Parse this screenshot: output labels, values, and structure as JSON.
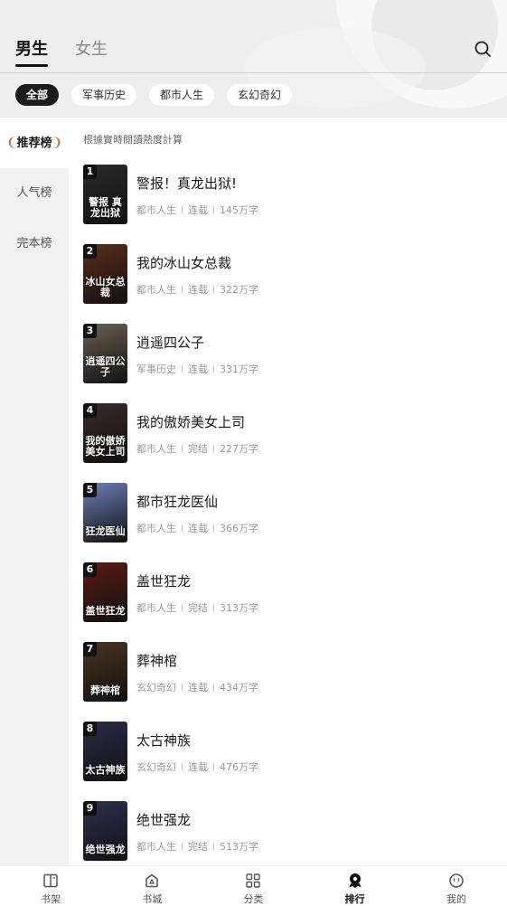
{
  "header": {
    "tabs": [
      {
        "label": "男生"
      },
      {
        "label": "女生"
      }
    ]
  },
  "chips": [
    {
      "label": "全部"
    },
    {
      "label": "军事历史"
    },
    {
      "label": "都市人生"
    },
    {
      "label": "玄幻奇幻"
    }
  ],
  "sidebar": {
    "items": [
      {
        "label": "推荐榜"
      },
      {
        "label": "人气榜"
      },
      {
        "label": "完本榜"
      }
    ]
  },
  "list": {
    "note": "根據實時閱讀熱度計算",
    "books": [
      {
        "rank": "1",
        "title": "警报！真龙出狱!",
        "category": "都市人生",
        "status": "连载",
        "words": "145万字",
        "cover_text": "警报 真龙出狱",
        "cover_color": "#2a2a2a"
      },
      {
        "rank": "2",
        "title": "我的冰山女总裁",
        "category": "都市人生",
        "status": "连载",
        "words": "322万字",
        "cover_text": "冰山女总裁",
        "cover_color": "#5a2d1a"
      },
      {
        "rank": "3",
        "title": "逍遥四公子",
        "category": "军事历史",
        "status": "连载",
        "words": "331万字",
        "cover_text": "逍遥四公子",
        "cover_color": "#6b5f52"
      },
      {
        "rank": "4",
        "title": "我的傲娇美女上司",
        "category": "都市人生",
        "status": "完结",
        "words": "227万字",
        "cover_text": "我的傲娇美女上司",
        "cover_color": "#3a2a28"
      },
      {
        "rank": "5",
        "title": "都市狂龙医仙",
        "category": "都市人生",
        "status": "连载",
        "words": "366万字",
        "cover_text": "狂龙医仙",
        "cover_color": "#6d7fb8"
      },
      {
        "rank": "6",
        "title": "盖世狂龙",
        "category": "都市人生",
        "status": "完结",
        "words": "313万字",
        "cover_text": "盖世狂龙",
        "cover_color": "#5c1a12"
      },
      {
        "rank": "7",
        "title": "葬神棺",
        "category": "玄幻奇幻",
        "status": "连载",
        "words": "434万字",
        "cover_text": "葬神棺",
        "cover_color": "#4a3420"
      },
      {
        "rank": "8",
        "title": "太古神族",
        "category": "玄幻奇幻",
        "status": "连载",
        "words": "476万字",
        "cover_text": "太古神族",
        "cover_color": "#2c2a4a"
      },
      {
        "rank": "9",
        "title": "绝世强龙",
        "category": "都市人生",
        "status": "完结",
        "words": "513万字",
        "cover_text": "绝世强龙",
        "cover_color": "#2b3150"
      }
    ]
  },
  "bottom_nav": {
    "items": [
      {
        "label": "书架",
        "icon": "bookshelf-icon"
      },
      {
        "label": "书城",
        "icon": "bookstore-icon"
      },
      {
        "label": "分类",
        "icon": "category-icon"
      },
      {
        "label": "排行",
        "icon": "ranking-icon"
      },
      {
        "label": "我的",
        "icon": "profile-icon"
      }
    ]
  },
  "colors": {
    "accent": "#111111",
    "laurel": "#b8854a",
    "sidebar_bg": "#f1f1f1",
    "header_bg": "#eeeeee"
  }
}
